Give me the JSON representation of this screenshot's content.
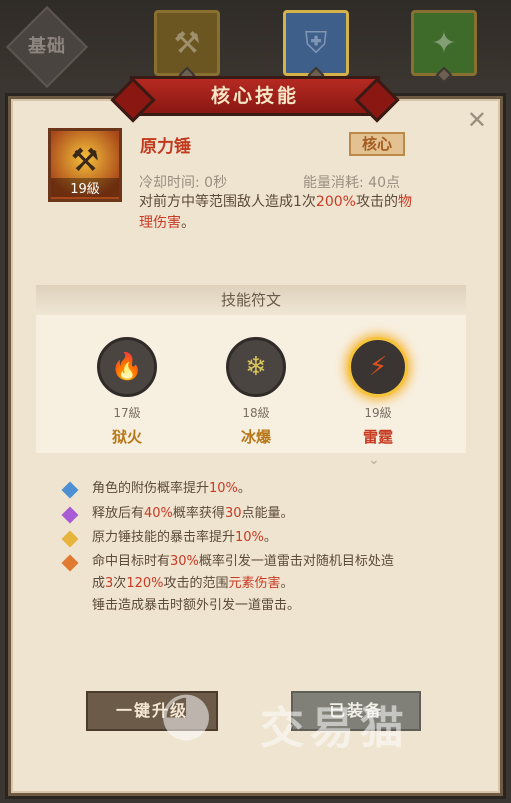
{
  "tabs": {
    "base": "基础",
    "items": [
      {
        "icon": "hammer-icon",
        "color": "#6b5520"
      },
      {
        "icon": "armor-icon",
        "color": "#3d5f8a"
      },
      {
        "icon": "gem-icon",
        "color": "#3f6b2a"
      }
    ]
  },
  "header": {
    "title": "核心技能"
  },
  "skill": {
    "name": "原力锤",
    "level": "19級",
    "badge": "核心",
    "cooldown": "冷却时间: 0秒",
    "energy": "能量消耗: 40点",
    "desc_a": "对前方中等范围敌人造成1次",
    "desc_hl": "200%",
    "desc_b": "攻击的",
    "desc_c": "物",
    "desc_d": "理伤害",
    "desc_e": "。"
  },
  "runes": {
    "title": "技能符文",
    "items": [
      {
        "level": "17級",
        "name": "狱火",
        "icon": "fire-icon"
      },
      {
        "level": "18級",
        "name": "冰爆",
        "icon": "ice-icon"
      },
      {
        "level": "19級",
        "name": "雷霆",
        "icon": "thunder-icon"
      }
    ]
  },
  "effects": [
    {
      "a": "角色的附伤概率提升",
      "hl": "10%",
      "b": "。",
      "color": "#4d8fd3"
    },
    {
      "a": "释放后有",
      "hl": "40%",
      "b": "概率获得",
      "hl2": "30",
      "c": "点能量。",
      "color": "#a95bd6"
    },
    {
      "a": "原力锤技能的暴击率提升",
      "hl": "10%",
      "b": "。",
      "color": "#e6b43c"
    },
    {
      "a": "命中目标时有",
      "hl": "30%",
      "b": "概率引发一道雷击对随机目标处造",
      "c": "成",
      "hl2": "3",
      "d": "次",
      "hl3": "120%",
      "e": "攻击的范围",
      "hl4": "元素伤害",
      "f": "。",
      "g": "锤击造成暴击时额外引发一道雷击。",
      "color": "#e07a30"
    }
  ],
  "buttons": {
    "upgrade": "一键升级",
    "equipped": "已装备"
  },
  "watermark": {
    "text": "交易猫"
  }
}
